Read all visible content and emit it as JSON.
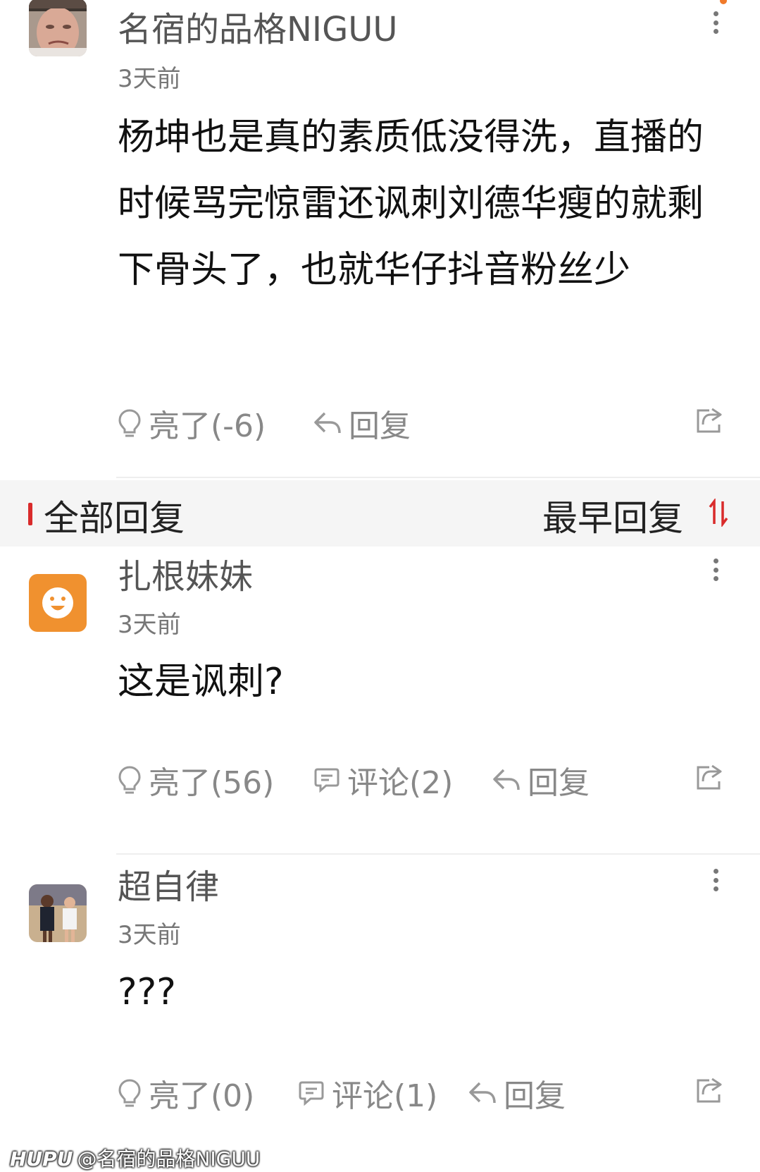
{
  "main_comment": {
    "username": "名宿的品格NIGUU",
    "time": "3天前",
    "text": "杨坤也是真的素质低没得洗，直播的时候骂完惊雷还讽刺刘德华瘦的就剩下骨头了，也就华仔抖音粉丝少",
    "like_label": "亮了(-6)",
    "reply_label": "回复"
  },
  "section": {
    "title": "全部回复",
    "sort_label": "最早回复"
  },
  "replies": [
    {
      "username": "扎根妹妹",
      "time": "3天前",
      "text": "这是讽刺?",
      "like_label": "亮了(56)",
      "comment_label": "评论(2)",
      "reply_label": "回复"
    },
    {
      "username": "超自律",
      "time": "3天前",
      "text": "???",
      "like_label": "亮了(0)",
      "comment_label": "评论(1)",
      "reply_label": "回复"
    }
  ],
  "watermark": {
    "brand": "HUPU",
    "handle": "@名宿的品格NIGUU"
  },
  "colors": {
    "accent_red": "#d92b2b",
    "default_avatar_orange": "#f0912f",
    "icon_gray": "#888888"
  }
}
